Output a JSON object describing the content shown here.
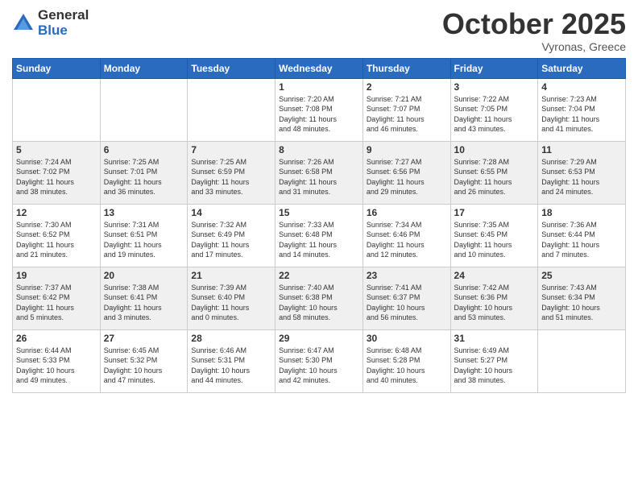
{
  "logo": {
    "general": "General",
    "blue": "Blue"
  },
  "header": {
    "month": "October 2025",
    "location": "Vyronas, Greece"
  },
  "weekdays": [
    "Sunday",
    "Monday",
    "Tuesday",
    "Wednesday",
    "Thursday",
    "Friday",
    "Saturday"
  ],
  "weeks": [
    [
      {
        "day": "",
        "info": ""
      },
      {
        "day": "",
        "info": ""
      },
      {
        "day": "",
        "info": ""
      },
      {
        "day": "1",
        "info": "Sunrise: 7:20 AM\nSunset: 7:08 PM\nDaylight: 11 hours\nand 48 minutes."
      },
      {
        "day": "2",
        "info": "Sunrise: 7:21 AM\nSunset: 7:07 PM\nDaylight: 11 hours\nand 46 minutes."
      },
      {
        "day": "3",
        "info": "Sunrise: 7:22 AM\nSunset: 7:05 PM\nDaylight: 11 hours\nand 43 minutes."
      },
      {
        "day": "4",
        "info": "Sunrise: 7:23 AM\nSunset: 7:04 PM\nDaylight: 11 hours\nand 41 minutes."
      }
    ],
    [
      {
        "day": "5",
        "info": "Sunrise: 7:24 AM\nSunset: 7:02 PM\nDaylight: 11 hours\nand 38 minutes."
      },
      {
        "day": "6",
        "info": "Sunrise: 7:25 AM\nSunset: 7:01 PM\nDaylight: 11 hours\nand 36 minutes."
      },
      {
        "day": "7",
        "info": "Sunrise: 7:25 AM\nSunset: 6:59 PM\nDaylight: 11 hours\nand 33 minutes."
      },
      {
        "day": "8",
        "info": "Sunrise: 7:26 AM\nSunset: 6:58 PM\nDaylight: 11 hours\nand 31 minutes."
      },
      {
        "day": "9",
        "info": "Sunrise: 7:27 AM\nSunset: 6:56 PM\nDaylight: 11 hours\nand 29 minutes."
      },
      {
        "day": "10",
        "info": "Sunrise: 7:28 AM\nSunset: 6:55 PM\nDaylight: 11 hours\nand 26 minutes."
      },
      {
        "day": "11",
        "info": "Sunrise: 7:29 AM\nSunset: 6:53 PM\nDaylight: 11 hours\nand 24 minutes."
      }
    ],
    [
      {
        "day": "12",
        "info": "Sunrise: 7:30 AM\nSunset: 6:52 PM\nDaylight: 11 hours\nand 21 minutes."
      },
      {
        "day": "13",
        "info": "Sunrise: 7:31 AM\nSunset: 6:51 PM\nDaylight: 11 hours\nand 19 minutes."
      },
      {
        "day": "14",
        "info": "Sunrise: 7:32 AM\nSunset: 6:49 PM\nDaylight: 11 hours\nand 17 minutes."
      },
      {
        "day": "15",
        "info": "Sunrise: 7:33 AM\nSunset: 6:48 PM\nDaylight: 11 hours\nand 14 minutes."
      },
      {
        "day": "16",
        "info": "Sunrise: 7:34 AM\nSunset: 6:46 PM\nDaylight: 11 hours\nand 12 minutes."
      },
      {
        "day": "17",
        "info": "Sunrise: 7:35 AM\nSunset: 6:45 PM\nDaylight: 11 hours\nand 10 minutes."
      },
      {
        "day": "18",
        "info": "Sunrise: 7:36 AM\nSunset: 6:44 PM\nDaylight: 11 hours\nand 7 minutes."
      }
    ],
    [
      {
        "day": "19",
        "info": "Sunrise: 7:37 AM\nSunset: 6:42 PM\nDaylight: 11 hours\nand 5 minutes."
      },
      {
        "day": "20",
        "info": "Sunrise: 7:38 AM\nSunset: 6:41 PM\nDaylight: 11 hours\nand 3 minutes."
      },
      {
        "day": "21",
        "info": "Sunrise: 7:39 AM\nSunset: 6:40 PM\nDaylight: 11 hours\nand 0 minutes."
      },
      {
        "day": "22",
        "info": "Sunrise: 7:40 AM\nSunset: 6:38 PM\nDaylight: 10 hours\nand 58 minutes."
      },
      {
        "day": "23",
        "info": "Sunrise: 7:41 AM\nSunset: 6:37 PM\nDaylight: 10 hours\nand 56 minutes."
      },
      {
        "day": "24",
        "info": "Sunrise: 7:42 AM\nSunset: 6:36 PM\nDaylight: 10 hours\nand 53 minutes."
      },
      {
        "day": "25",
        "info": "Sunrise: 7:43 AM\nSunset: 6:34 PM\nDaylight: 10 hours\nand 51 minutes."
      }
    ],
    [
      {
        "day": "26",
        "info": "Sunrise: 6:44 AM\nSunset: 5:33 PM\nDaylight: 10 hours\nand 49 minutes."
      },
      {
        "day": "27",
        "info": "Sunrise: 6:45 AM\nSunset: 5:32 PM\nDaylight: 10 hours\nand 47 minutes."
      },
      {
        "day": "28",
        "info": "Sunrise: 6:46 AM\nSunset: 5:31 PM\nDaylight: 10 hours\nand 44 minutes."
      },
      {
        "day": "29",
        "info": "Sunrise: 6:47 AM\nSunset: 5:30 PM\nDaylight: 10 hours\nand 42 minutes."
      },
      {
        "day": "30",
        "info": "Sunrise: 6:48 AM\nSunset: 5:28 PM\nDaylight: 10 hours\nand 40 minutes."
      },
      {
        "day": "31",
        "info": "Sunrise: 6:49 AM\nSunset: 5:27 PM\nDaylight: 10 hours\nand 38 minutes."
      },
      {
        "day": "",
        "info": ""
      }
    ]
  ]
}
